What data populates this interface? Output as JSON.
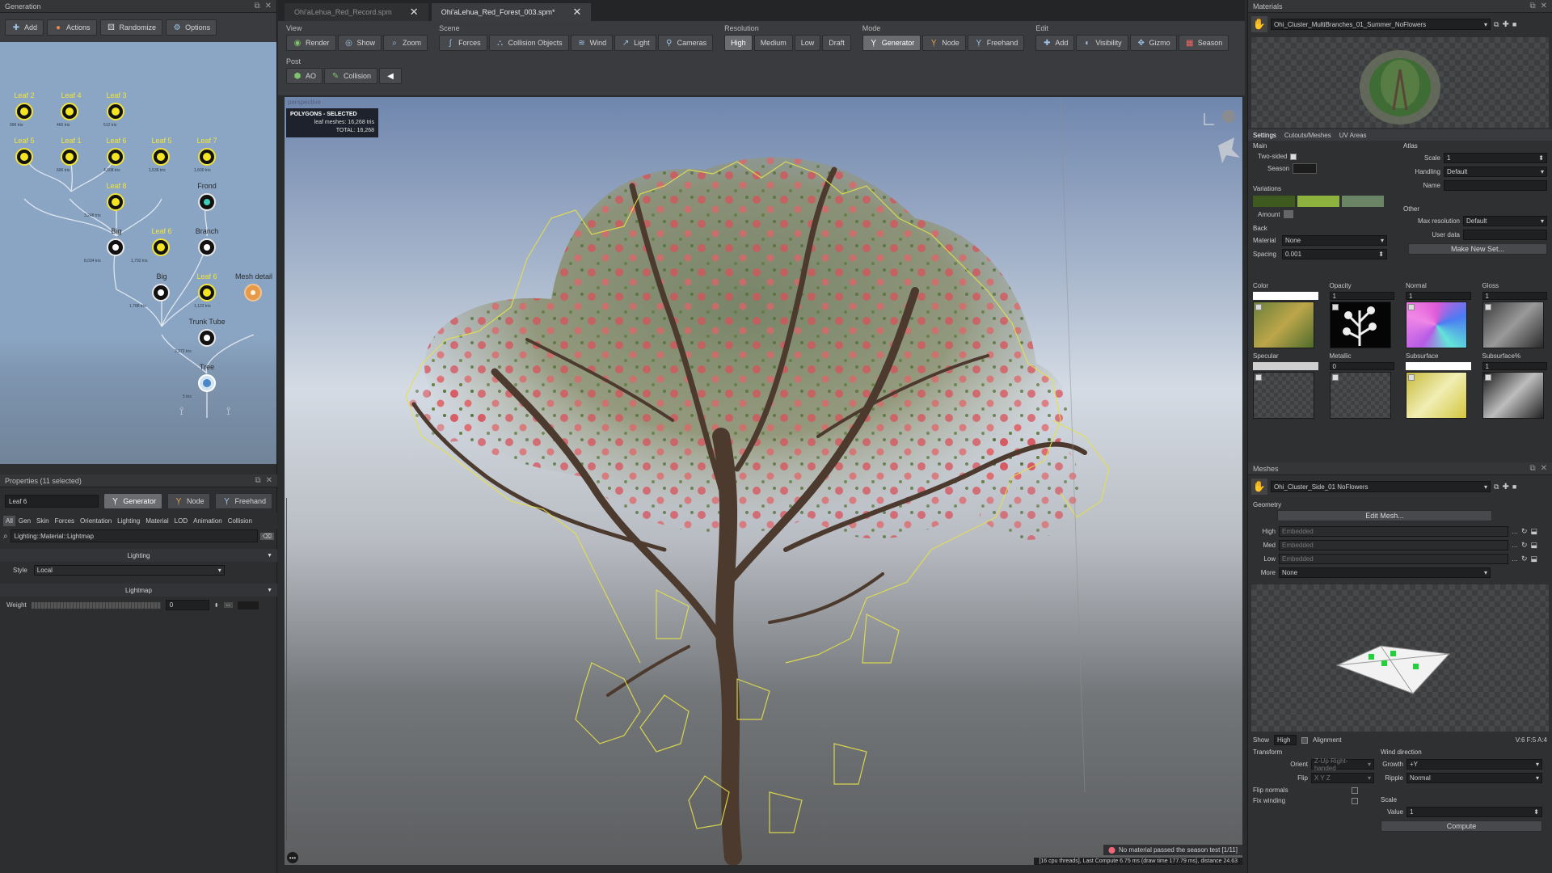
{
  "generation": {
    "title": "Generation",
    "toolbar": [
      {
        "label": "Add",
        "icon": "plus-icon"
      },
      {
        "label": "Actions",
        "icon": "actions-icon"
      },
      {
        "label": "Randomize",
        "icon": "dice-icon"
      },
      {
        "label": "Options",
        "icon": "gear-icon"
      }
    ],
    "nodes": {
      "leaf2": "Leaf 2",
      "leaf4": "Leaf 4",
      "leaf3": "Leaf 3",
      "leaf5": "Leaf 5",
      "leaf1": "Leaf 1",
      "leaf6a": "Leaf 6",
      "leaf7": "Leaf 7",
      "leaf8": "Leaf 8",
      "frond": "Frond",
      "big": "Big",
      "leaf6b": "Leaf 6",
      "branch": "Branch",
      "big2": "Big",
      "leaf6c": "Leaf 6",
      "mesh_detail": "Mesh detail",
      "trunk_tube": "Trunk Tube",
      "tree": "Tree"
    },
    "stats": {
      "s1": "996 tris",
      "s2": "460 tris",
      "s3": "512 tris",
      "s4": "696 tris",
      "s5": "4,608 tris",
      "s6": "1,536 tris",
      "s7": "1,600 tris",
      "s8": "3,248 tris",
      "s9": "8,034 tris",
      "s10": "1,792 tris",
      "s11": "1,122 tris",
      "s12": "1,788 tris",
      "s13": "3,272 tris",
      "s14": "5 tris"
    }
  },
  "properties": {
    "title": "Properties (11 selected)",
    "name_value": "Leaf 6",
    "mode_buttons": [
      "Generator",
      "Node",
      "Freehand"
    ],
    "tabs": [
      "All",
      "Gen",
      "Skin",
      "Forces",
      "Orientation",
      "Lighting",
      "Material",
      "LOD",
      "Animation",
      "Collision"
    ],
    "search_value": "Lighting::Material::Lightmap",
    "section_lighting": "Lighting",
    "style_label": "Style",
    "style_value": "Local",
    "section_lightmap": "Lightmap",
    "weight_label": "Weight",
    "weight_value": "0"
  },
  "tabs": [
    {
      "label": "Ohi'aLehua_Red_Record.spm",
      "active": false
    },
    {
      "label": "Ohi'aLehua_Red_Forest_003.spm*",
      "active": true
    }
  ],
  "toolbar": {
    "view_label": "View",
    "view": [
      "Render",
      "Show",
      "Zoom"
    ],
    "scene_label": "Scene",
    "scene": [
      "Forces",
      "Collision Objects",
      "Wind",
      "Light",
      "Cameras"
    ],
    "resolution_label": "Resolution",
    "resolution": [
      "High",
      "Medium",
      "Low",
      "Draft"
    ],
    "mode_label": "Mode",
    "mode": [
      "Generator",
      "Node",
      "Freehand"
    ],
    "edit_label": "Edit",
    "edit": [
      "Add",
      "Visibility",
      "Gizmo",
      "Season"
    ],
    "post_label": "Post",
    "post": [
      "AO",
      "Collision"
    ]
  },
  "viewport": {
    "camera_label": "perspective",
    "poly_title": "POLYGONS - SELECTED",
    "leaf_meshes": "leaf meshes: 16,268 tris",
    "total": "TOTAL: 16,268",
    "status_msg": "No material passed the season test [1/11]",
    "compute_msg": "[16 cpu threads], Last Compute 6.75 ms (draw time 177.79 ms), distance 24.63"
  },
  "materials": {
    "title": "Materials",
    "selected": "Ohi_Cluster_MultiBranches_01_Summer_NoFlowers",
    "tabs": [
      "Settings",
      "Cutouts/Meshes",
      "UV Areas"
    ],
    "main_label": "Main",
    "two_sided": "Two-sided",
    "season": "Season",
    "variations_label": "Variations",
    "amount": "Amount",
    "back_label": "Back",
    "back_material": "Material",
    "back_material_value": "None",
    "spacing": "Spacing",
    "spacing_value": "0.001",
    "atlas_label": "Atlas",
    "scale": "Scale",
    "scale_value": "1",
    "handling": "Handling",
    "handling_value": "Default",
    "name_label": "Name",
    "other_label": "Other",
    "max_res": "Max resolution",
    "max_res_value": "Default",
    "user_data": "User data",
    "make_new_set": "Make New Set...",
    "maps": [
      {
        "label": "Color",
        "value": ""
      },
      {
        "label": "Opacity",
        "value": "1"
      },
      {
        "label": "Normal",
        "value": "1"
      },
      {
        "label": "Gloss",
        "value": "1"
      },
      {
        "label": "Specular",
        "value": ""
      },
      {
        "label": "Metallic",
        "value": "0"
      },
      {
        "label": "Subsurface",
        "value": ""
      },
      {
        "label": "Subsurface%",
        "value": "1"
      }
    ],
    "variation_colors": [
      "#3f5a1e",
      "#8db33e",
      "#6b8465"
    ]
  },
  "meshes": {
    "title": "Meshes",
    "selected": "Ohi_Cluster_Side_01 NoFlowers",
    "geometry": "Geometry",
    "edit_mesh": "Edit Mesh...",
    "lods": [
      {
        "label": "High",
        "value": "Embedded"
      },
      {
        "label": "Med",
        "value": "Embedded"
      },
      {
        "label": "Low",
        "value": "Embedded"
      }
    ],
    "more": "More",
    "more_value": "None",
    "show": "Show",
    "show_value": "High",
    "alignment": "Alignment",
    "counts": "V:6 F:5 A:4",
    "transform": "Transform",
    "orient": "Orient",
    "orient_value": "Z-Up Right-handed",
    "flip": "Flip",
    "flip_value": "X Y Z",
    "flip_normals": "Flip normals",
    "fix_winding": "Fix winding",
    "wind_direction": "Wind direction",
    "growth": "Growth",
    "growth_value": "+Y",
    "ripple": "Ripple",
    "ripple_value": "Normal",
    "scale_label": "Scale",
    "value_label": "Value",
    "value_value": "1",
    "compute": "Compute"
  }
}
